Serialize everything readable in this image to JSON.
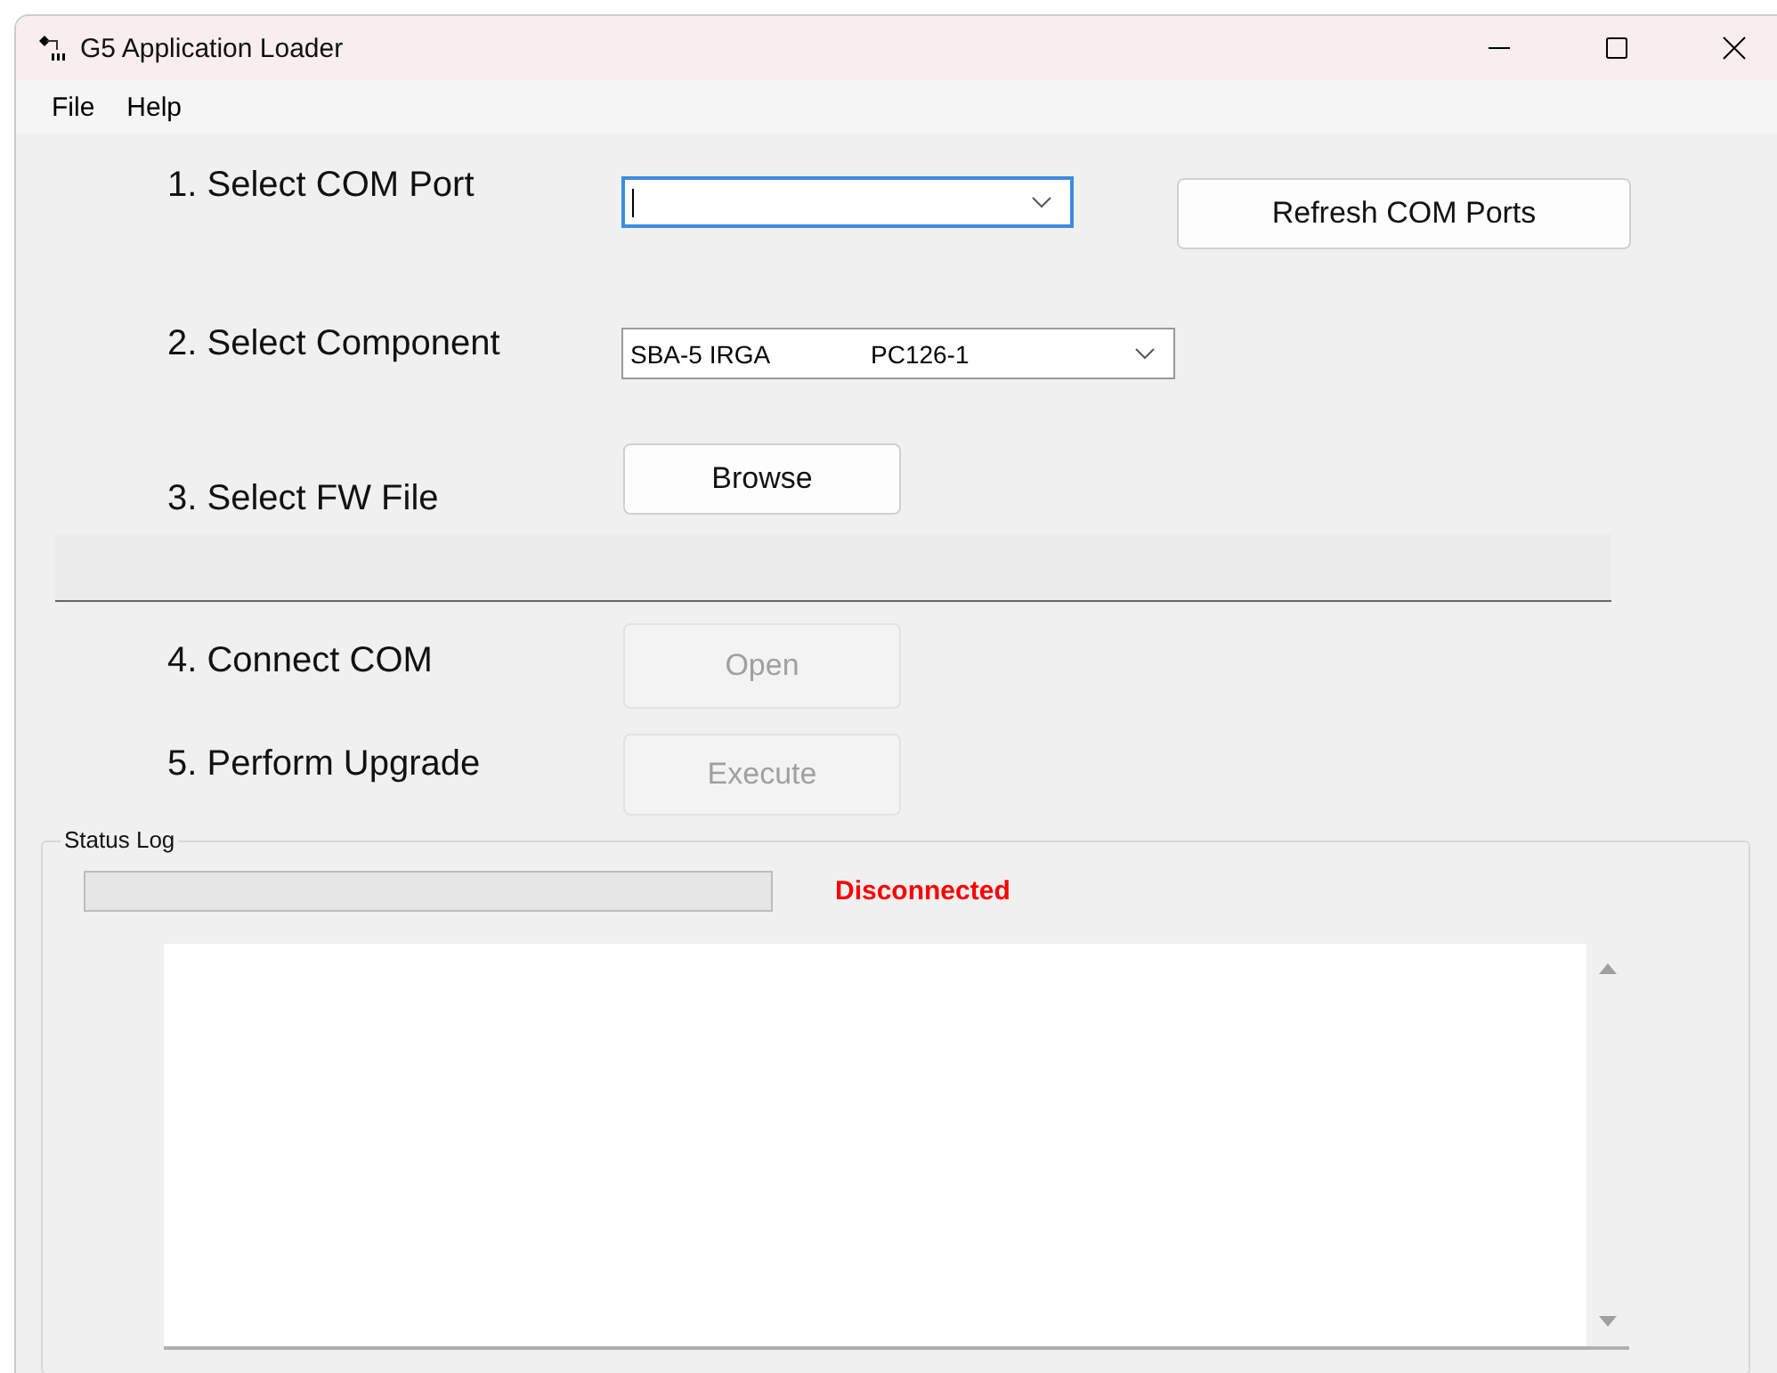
{
  "window": {
    "title": "G5 Application Loader"
  },
  "menu": [
    "File",
    "Help"
  ],
  "steps": [
    {
      "label": "1. Select COM Port",
      "kind": "combo",
      "focused": true,
      "button": {
        "label": "Refresh COM Ports",
        "disabled": false
      }
    },
    {
      "label": "2. Select Component",
      "kind": "combo",
      "value": "SBA-5 IRGA",
      "value_2": "PC126-1",
      "focused": false
    },
    {
      "label": "3. Select FW File",
      "kind": "button",
      "button": {
        "label": "Browse",
        "disabled": false
      }
    },
    {
      "kind": "path"
    },
    {
      "label": "4. Connect COM",
      "kind": "button",
      "button": {
        "label": "Open",
        "disabled": true
      }
    },
    {
      "label": "5. Perform Upgrade",
      "kind": "button",
      "button": {
        "label": "Execute",
        "disabled": true
      }
    }
  ],
  "status_log": {
    "title": "Status Log",
    "progress": {
      "level": 0
    },
    "status": "Disconnected",
    "connected": false
  }
}
